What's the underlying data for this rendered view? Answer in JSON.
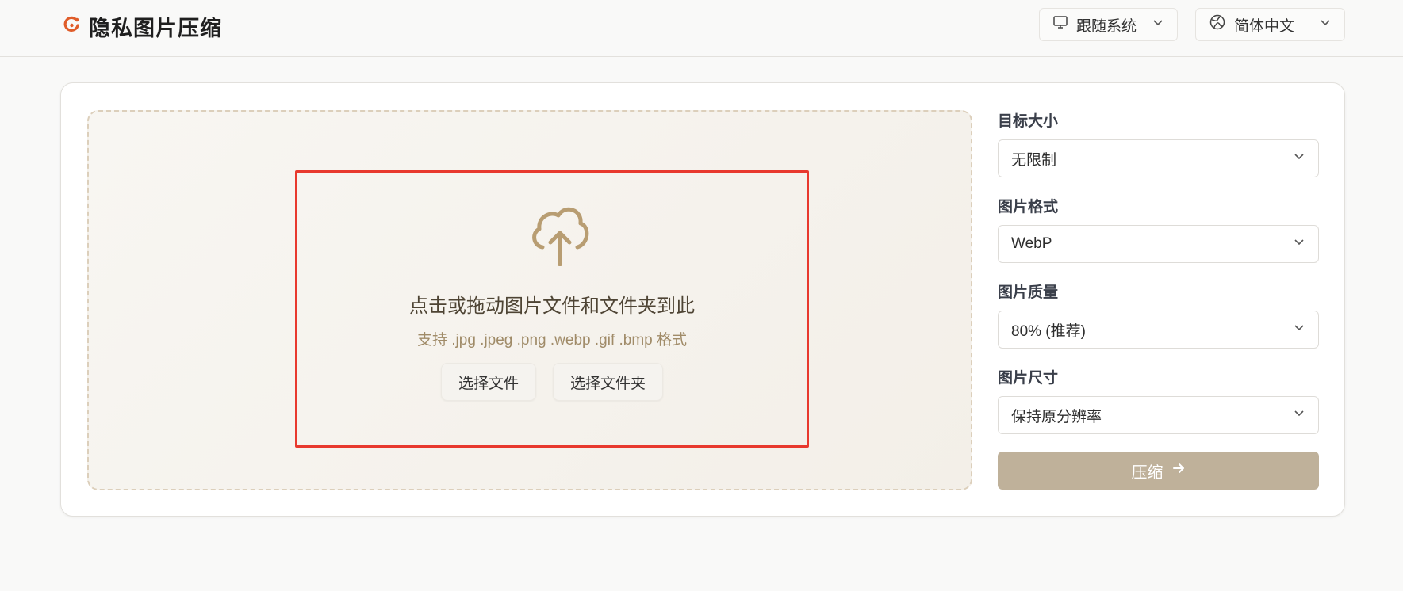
{
  "brand": {
    "title": "隐私图片压缩",
    "accent": "#e05d2a"
  },
  "header": {
    "theme": {
      "label": "跟随系统",
      "icon": "monitor-icon"
    },
    "language": {
      "label": "简体中文",
      "icon": "globe-icon"
    }
  },
  "dropzone": {
    "title": "点击或拖动图片文件和文件夹到此",
    "subtitle": "支持 .jpg .jpeg .png .webp .gif .bmp 格式",
    "select_file": "选择文件",
    "select_folder": "选择文件夹"
  },
  "options": {
    "target_size": {
      "label": "目标大小",
      "value": "无限制"
    },
    "format": {
      "label": "图片格式",
      "value": "WebP"
    },
    "quality": {
      "label": "图片质量",
      "value": "80% (推荐)"
    },
    "dimensions": {
      "label": "图片尺寸",
      "value": "保持原分辨率"
    }
  },
  "compress": {
    "label": "压缩",
    "color": "#bfb19a"
  }
}
